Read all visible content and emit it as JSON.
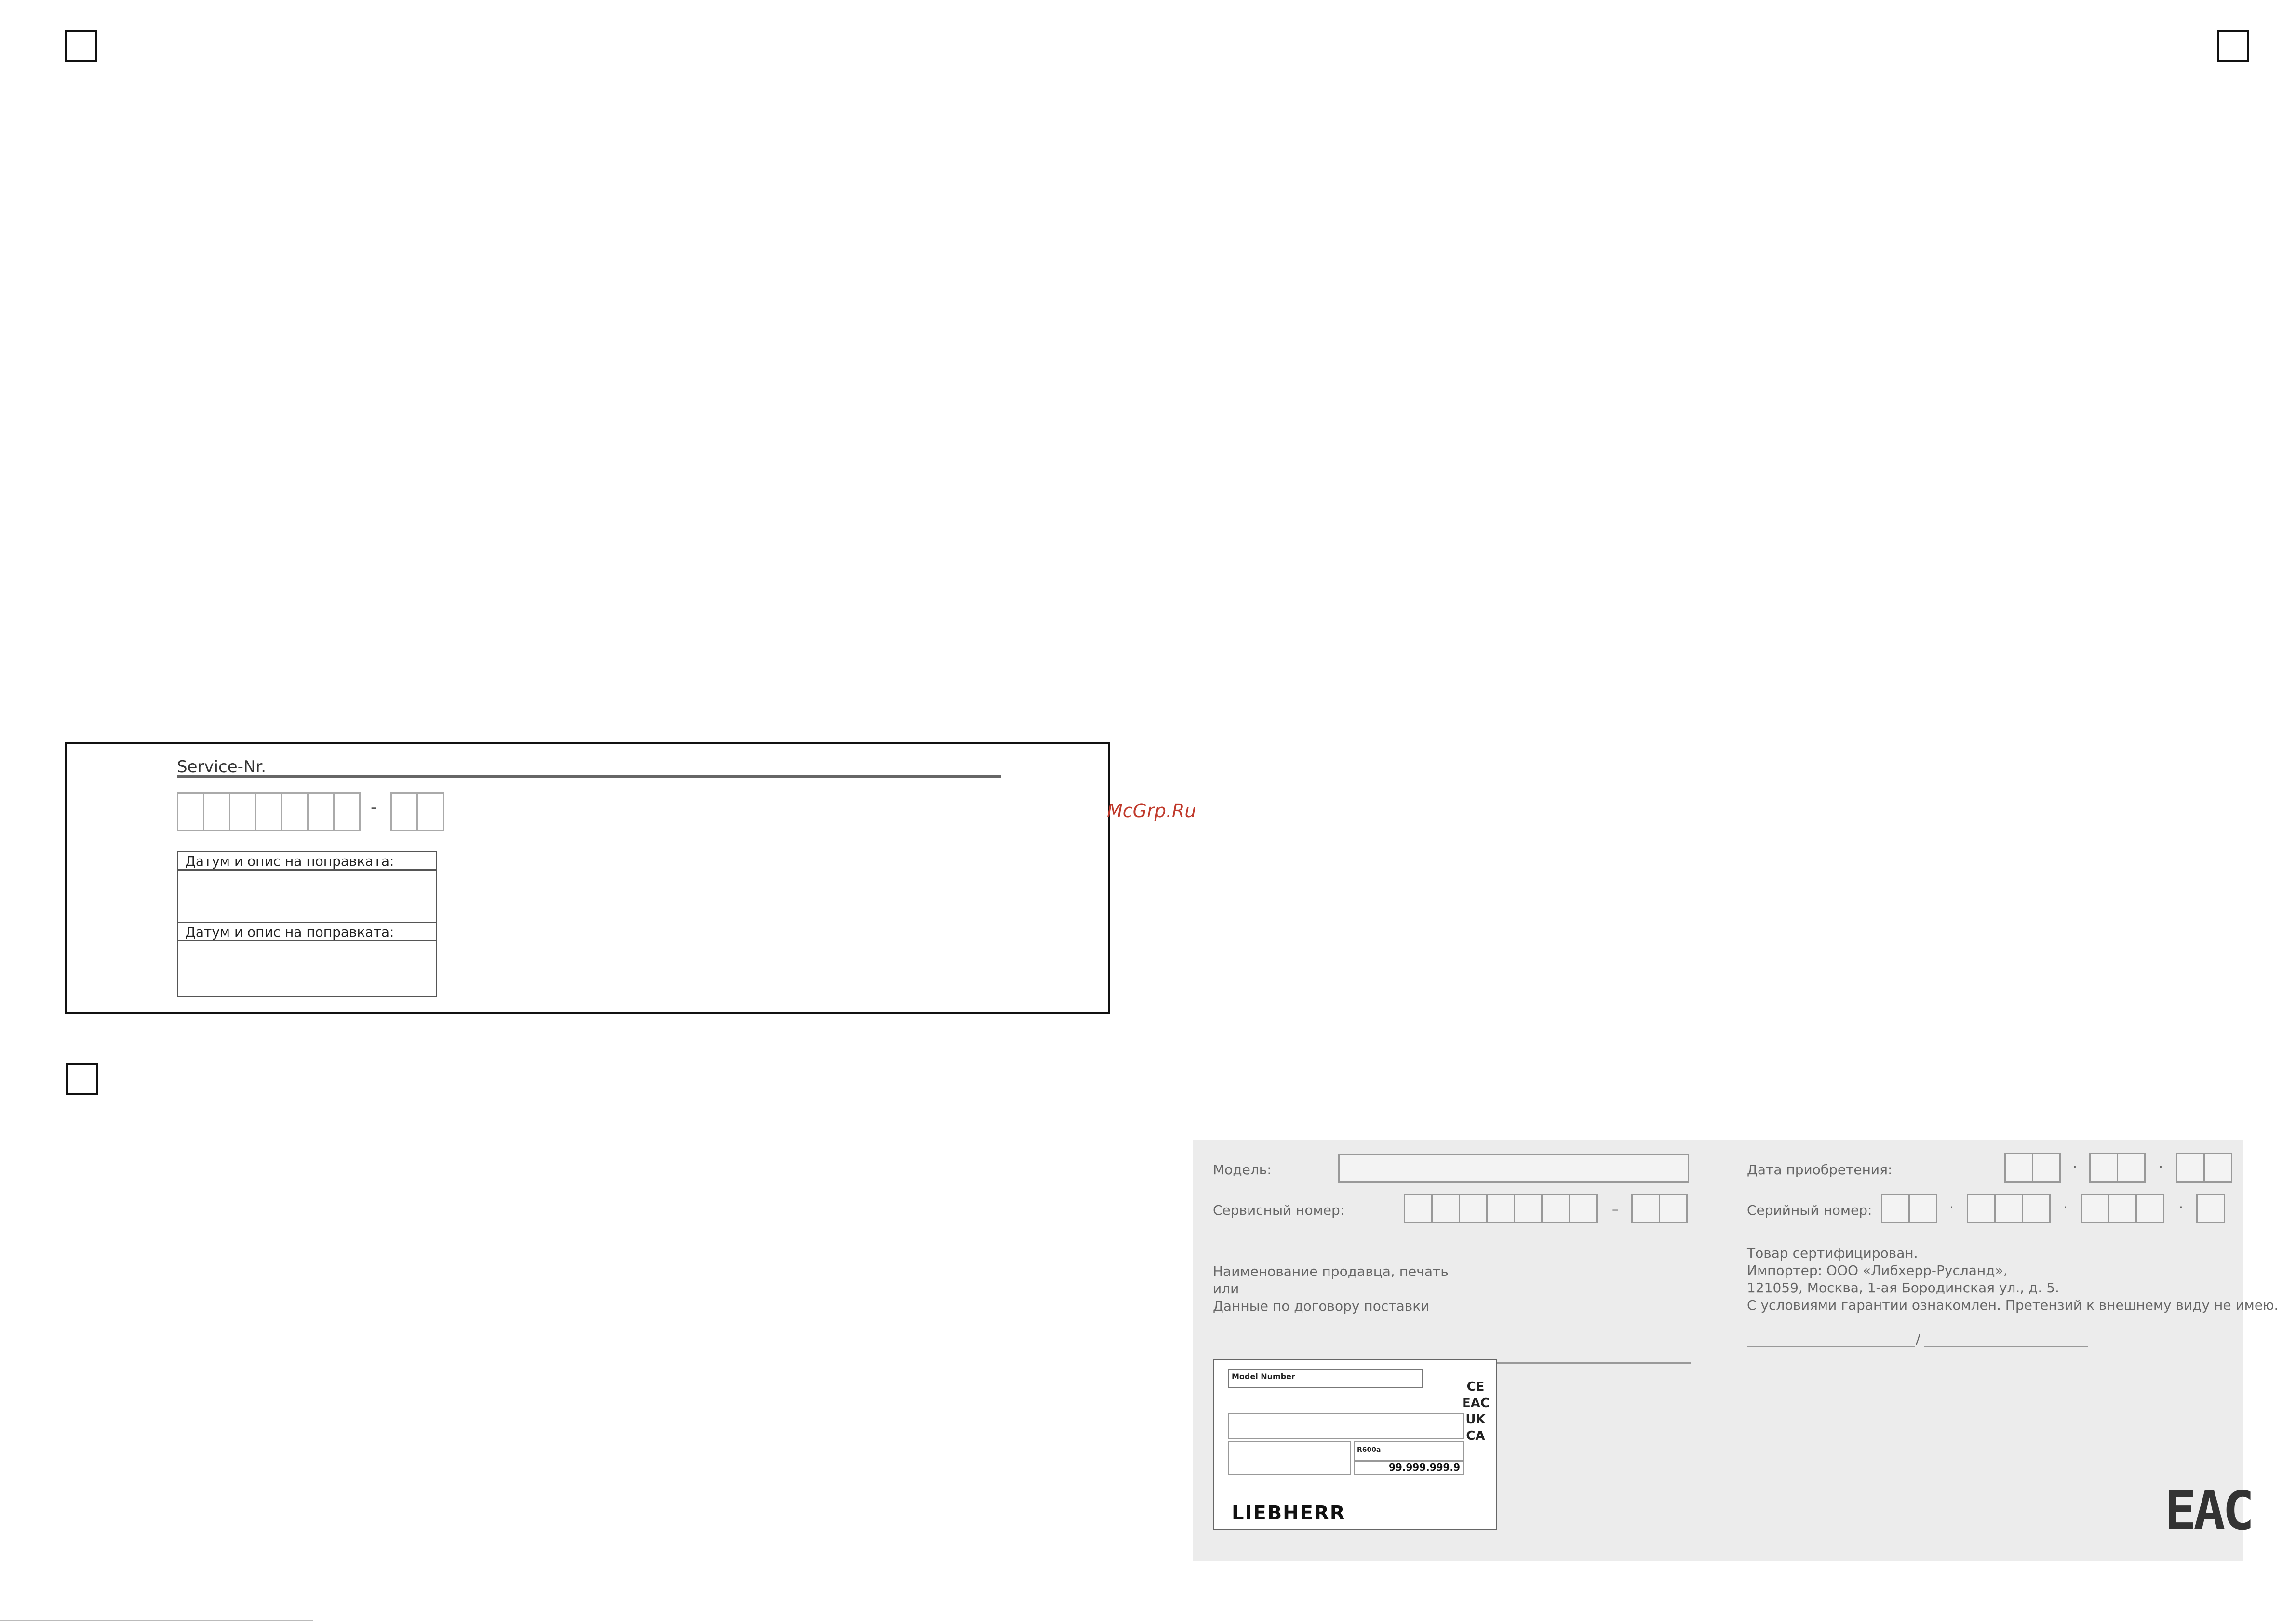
{
  "service_card": {
    "title": "Service-Nr.",
    "dash": "-",
    "repair_label_1": "Датум и опис на поправката:",
    "repair_label_2": "Датум и опис на поправката:"
  },
  "watermark": "McGrp.Ru",
  "warranty_card": {
    "model_label": "Модель:",
    "service_number_label": "Сервисный номер:",
    "service_dash": "–",
    "purchase_date_label": "Дата приобретения:",
    "serial_number_label": "Серийный номер:",
    "dot": "·",
    "seller_line_1": "Наименование продавца, печать",
    "seller_line_2": "или",
    "seller_line_3": "Данные по договору поставки",
    "cert_line_1": "Товар сертифицирован.",
    "cert_line_2": "Импортер: ООО «Либхерр-Русланд»,",
    "cert_line_3": "121059, Москва, 1-ая Бородинская ул., д. 5.",
    "cert_line_4": "С условиями гарантии ознакомлен. Претензий к внешнему виду не имею.",
    "sign_slash": "/",
    "eac_logo": "EAC"
  },
  "rating_plate": {
    "model_number": "Model Number",
    "gas": "R600a",
    "serial": "99.999.999.9",
    "brand": "LIEBHERR",
    "marks": [
      "CE",
      "EAC",
      "UK",
      "CA"
    ]
  }
}
